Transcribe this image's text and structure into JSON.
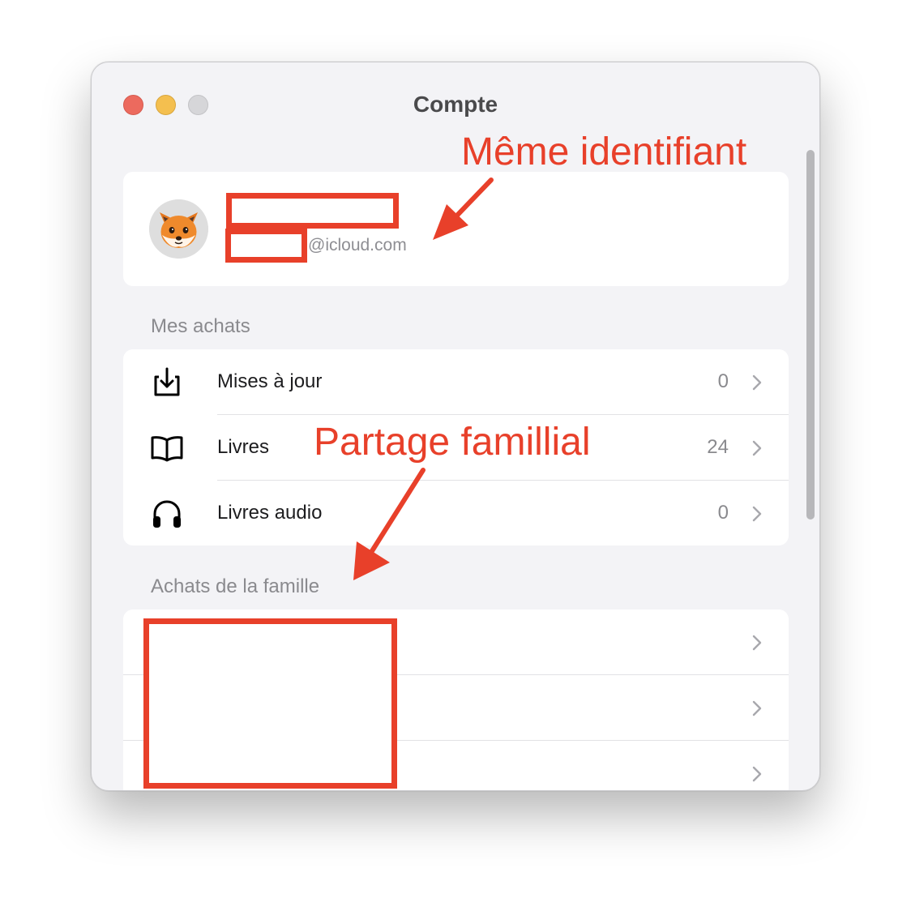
{
  "window": {
    "title": "Compte"
  },
  "account": {
    "email_domain": "@icloud.com",
    "avatar_icon": "fox-memoji"
  },
  "purchases": {
    "section_title": "Mes achats",
    "items": [
      {
        "label": "Mises à jour",
        "count": "0",
        "icon": "download-tray-icon"
      },
      {
        "label": "Livres",
        "count": "24",
        "icon": "book-icon"
      },
      {
        "label": "Livres audio",
        "count": "0",
        "icon": "headphones-icon"
      }
    ]
  },
  "family": {
    "section_title": "Achats de la famille",
    "row_count": 3
  },
  "annotations": {
    "same_id": "Même identifiant",
    "family_sharing": "Partage famillial",
    "color": "#e8402a"
  }
}
